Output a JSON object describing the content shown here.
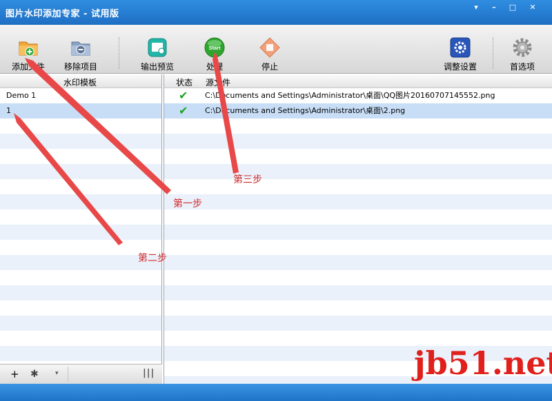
{
  "window": {
    "title": "图片水印添加专家 - 试用版",
    "controls": [
      "▾",
      "–",
      "□",
      "✕"
    ]
  },
  "toolbar": {
    "add_file": "添加文件",
    "remove_item": "移除项目",
    "output_preview": "输出预览",
    "process": "处理",
    "start_badge": "Start",
    "stop": "停止",
    "adjust_settings": "调整设置",
    "preferences": "首选项"
  },
  "templates": {
    "header": "水印模板",
    "items": [
      {
        "name": "Demo 1",
        "selected": false
      },
      {
        "name": "1",
        "selected": true
      }
    ],
    "footer": {
      "add": "+",
      "settings": "✱",
      "dropdown": "▾",
      "columns": "|||"
    }
  },
  "files": {
    "col_status": "状态",
    "col_source": "源文件",
    "rows": [
      {
        "status": "✔",
        "path": "C:\\Documents and Settings\\Administrator\\桌面\\QQ图片20160707145552.png",
        "selected": false
      },
      {
        "status": "✔",
        "path": "C:\\Documents and Settings\\Administrator\\桌面\\2.png",
        "selected": true
      }
    ]
  },
  "annotations": {
    "step1": "第一步",
    "step2": "第二步",
    "step3": "第三步"
  },
  "watermark": {
    "text": "jb51.net"
  },
  "colors": {
    "accent": "#1e6fc4",
    "annotation": "#d02b2b",
    "check": "#1aa51a"
  }
}
